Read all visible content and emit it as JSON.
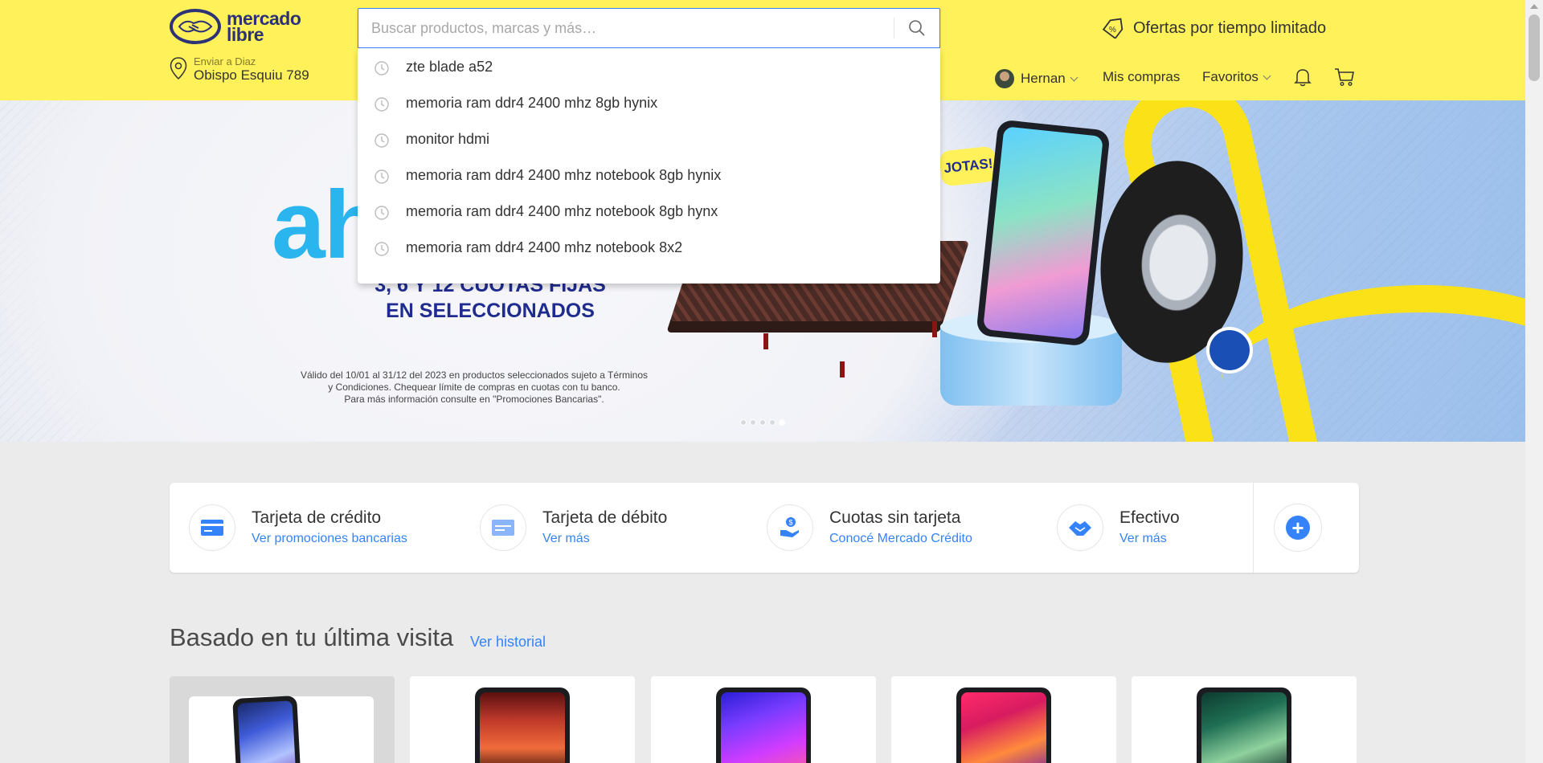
{
  "brand": {
    "name_line1": "mercado",
    "name_line2": "libre"
  },
  "location": {
    "label": "Enviar a Diaz",
    "address": "Obispo Esquiu 789"
  },
  "search": {
    "placeholder": "Buscar productos, marcas y más…",
    "value": "",
    "suggestions": [
      "zte blade a52",
      "memoria ram ddr4 2400 mhz 8gb hynix",
      "monitor hdmi",
      "memoria ram ddr4 2400 mhz notebook 8gb hynix",
      "memoria ram ddr4 2400 mhz notebook 8gb hynx",
      "memoria ram ddr4 2400 mhz notebook 8x2"
    ]
  },
  "promo": {
    "label": "Ofertas por tiempo limitado"
  },
  "nav": {
    "user": "Hernan",
    "purchases": "Mis compras",
    "favorites": "Favoritos"
  },
  "hero": {
    "headline_fragment": "ah",
    "cuotas_line1": "3, 6 Y 12 CUOTAS FIJAS",
    "cuotas_line2": "EN SELECCIONADOS",
    "badge_text": "JOTAS!",
    "legal_line1": "Válido del 10/01 al 31/12 del 2023 en productos seleccionados sujeto a Términos",
    "legal_line2": "y Condiciones. Chequear límite de compras en cuotas con tu banco.",
    "legal_line3": "Para más información consulte  en \"Promociones Bancarias\".",
    "carousel_count": 5,
    "carousel_active": 5
  },
  "payments": [
    {
      "title": "Tarjeta de crédito",
      "link": "Ver promociones bancarias",
      "icon": "credit-card-icon"
    },
    {
      "title": "Tarjeta de débito",
      "link": "Ver más",
      "icon": "debit-card-icon"
    },
    {
      "title": "Cuotas sin tarjeta",
      "link": "Conocé Mercado Crédito",
      "icon": "hand-coin-icon"
    },
    {
      "title": "Efectivo",
      "link": "Ver más",
      "icon": "handshake-cash-icon"
    }
  ],
  "section": {
    "title": "Basado en tu última visita",
    "link": "Ver historial"
  },
  "colors": {
    "header": "#fff159",
    "accent": "#3483fa",
    "brand_blue": "#2d3277"
  }
}
